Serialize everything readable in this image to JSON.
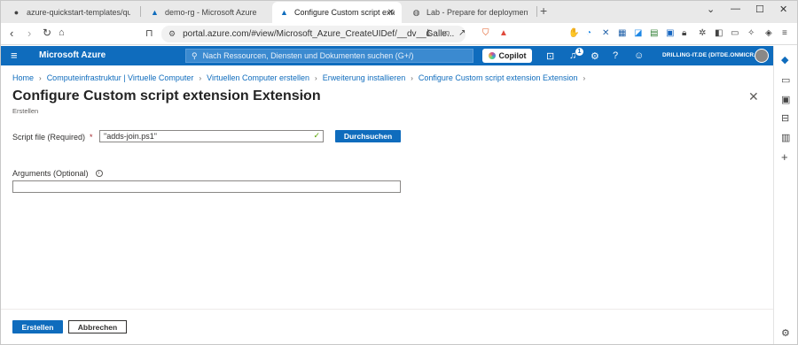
{
  "browser": {
    "tabs": [
      {
        "label": "azure-quickstart-templates/quickstart",
        "icon": "github-icon",
        "active": false
      },
      {
        "label": "demo-rg - Microsoft Azure",
        "icon": "azure-icon",
        "active": false
      },
      {
        "label": "Configure Custom script extens",
        "icon": "azure-icon",
        "active": true
      },
      {
        "label": "Lab - Prepare for deployment of Az",
        "icon": "globe-icon",
        "active": false
      }
    ],
    "new_tab": "+",
    "window_controls": {
      "chevron": "⌄",
      "minimize": "—",
      "maximize": "☐",
      "close": "✕"
    },
    "url": "portal.azure.com/#view/Microsoft_Azure_CreateUIDef/__dv__Galle..."
  },
  "azure_header": {
    "brand": "Microsoft Azure",
    "search_placeholder": "Nach Ressourcen, Diensten und Dokumenten suchen (G+/)",
    "copilot_label": "Copilot",
    "notification_count": "1",
    "tenant": "DRILLING-IT.DE (DITDE.ONMICR..."
  },
  "breadcrumb": [
    "Home",
    "Computeinfrastruktur | Virtuelle Computer",
    "Virtuellen Computer erstellen",
    "Erweiterung installieren",
    "Configure Custom script extension Extension"
  ],
  "blade": {
    "title": "Configure Custom script extension Extension",
    "more": "···",
    "subtitle": "Erstellen",
    "close": "✕"
  },
  "form": {
    "script_file_label": "Script file (Required)",
    "required_mark": "*",
    "script_file_value": "\"adds-join.ps1\"",
    "browse_label": "Durchsuchen",
    "arguments_label": "Arguments (Optional)",
    "arguments_value": ""
  },
  "footer": {
    "create_label": "Erstellen",
    "cancel_label": "Abbrechen"
  },
  "colors": {
    "azure_blue": "#0f6cbd",
    "valid_check": "#57a300",
    "required_red": "#a4262c"
  }
}
